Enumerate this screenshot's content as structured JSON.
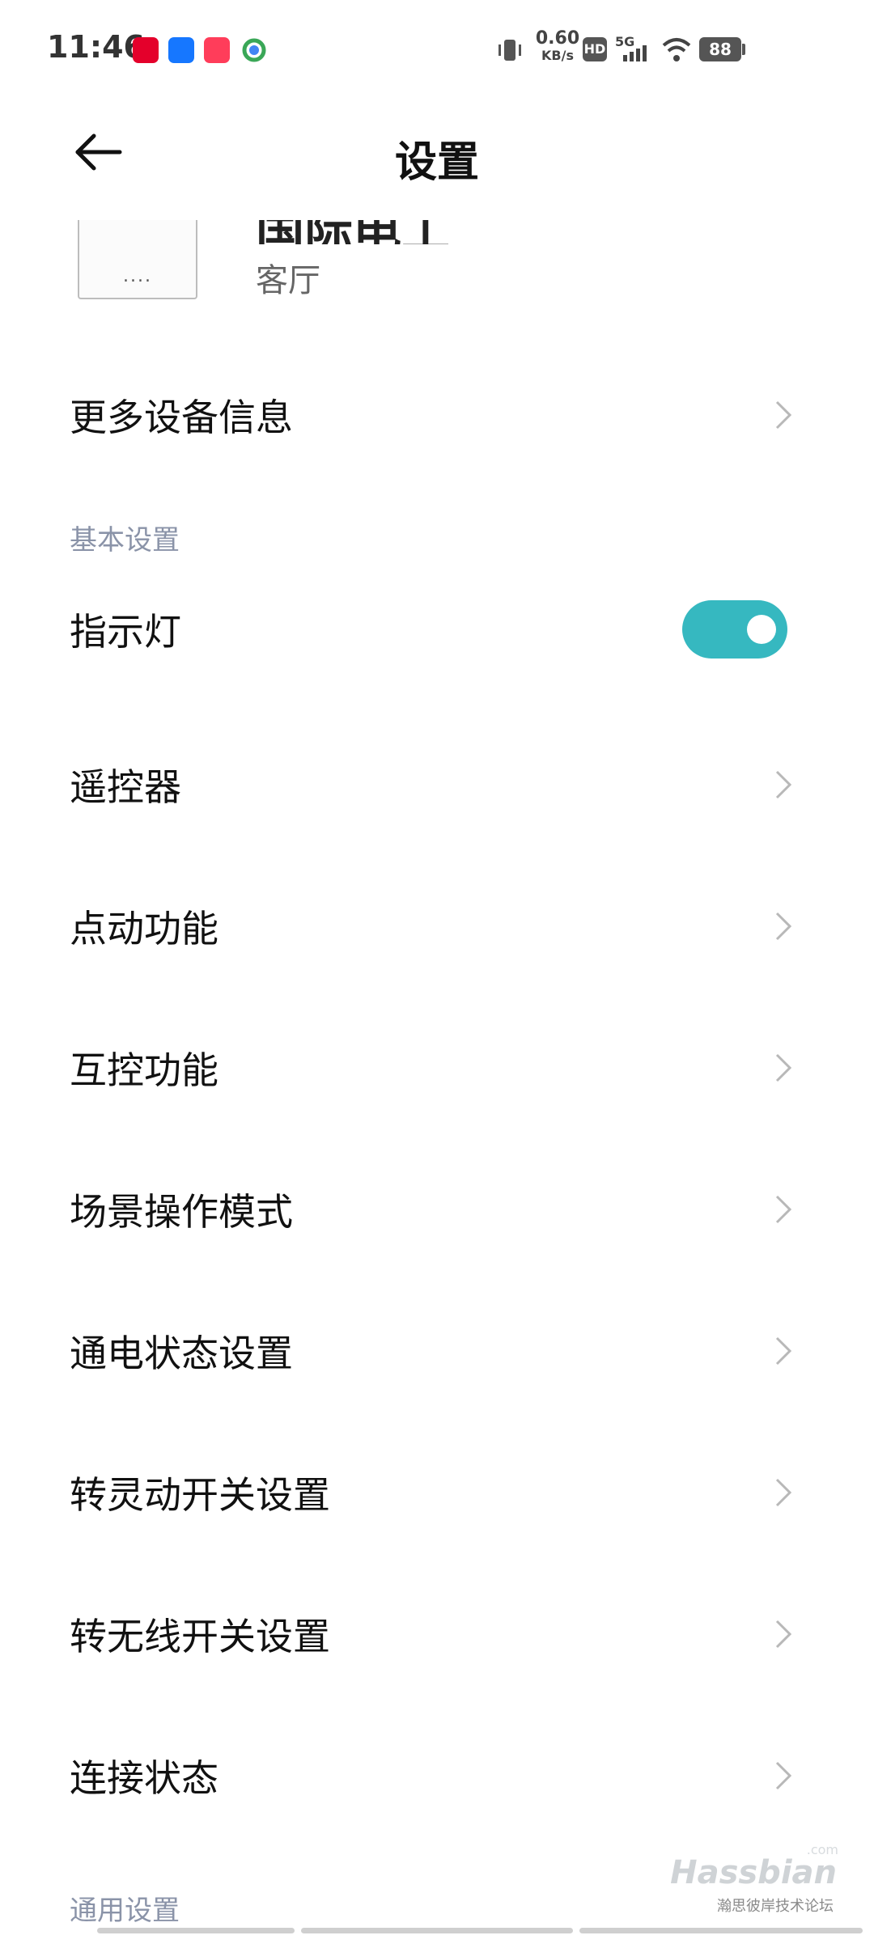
{
  "status_bar": {
    "time": "11:46",
    "app_icons": [
      "tmall-icon",
      "alipay-icon",
      "taobao-icon",
      "chrome-like-icon"
    ],
    "net_speed_value": "0.60",
    "net_speed_unit": "KB/s",
    "hd_label": "HD",
    "network_label": "5G",
    "battery": "88"
  },
  "header": {
    "title": "设置",
    "back_icon": "back-arrow-icon"
  },
  "device": {
    "thumb_text": "....",
    "name": "国际电工",
    "room": "客厅"
  },
  "more_info": {
    "label": "更多设备信息"
  },
  "sections": {
    "basic_title": "基本设置",
    "general_title": "通用设置"
  },
  "settings": {
    "indicator_label": "指示灯",
    "indicator_on": true,
    "items": [
      {
        "label": "遥控器"
      },
      {
        "label": "点动功能"
      },
      {
        "label": "互控功能"
      },
      {
        "label": "场景操作模式"
      },
      {
        "label": "通电状态设置"
      },
      {
        "label": "转灵动开关设置"
      },
      {
        "label": "转无线开关设置"
      },
      {
        "label": "连接状态"
      }
    ]
  },
  "watermark": {
    "brand": "Hassbian",
    "domain": ".com",
    "subtitle": "瀚思彼岸技术论坛"
  },
  "colors": {
    "accent": "#36b8c0",
    "section_header": "#8a93a8"
  }
}
